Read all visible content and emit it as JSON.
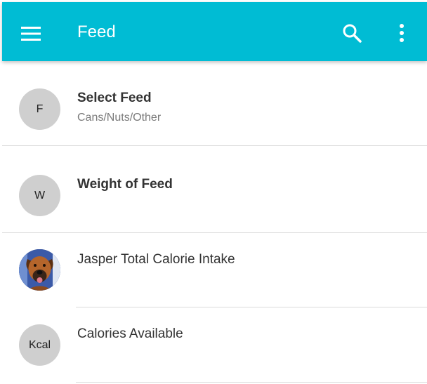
{
  "header": {
    "title": "Feed",
    "background": "#00bcd4",
    "menu_icon": "hamburger-menu-icon",
    "search_icon": "search-icon",
    "more_icon": "more-vertical-icon"
  },
  "list": {
    "items": [
      {
        "avatar_text": "F",
        "primary": "Select Feed",
        "secondary": "Cans/Nuts/Other"
      },
      {
        "avatar_text": "W",
        "primary": "Weight of Feed"
      },
      {
        "avatar_image": "dog-photo",
        "primary": "Jasper Total Calorie Intake"
      },
      {
        "avatar_text": "Kcal",
        "primary": "Calories Available"
      }
    ]
  }
}
